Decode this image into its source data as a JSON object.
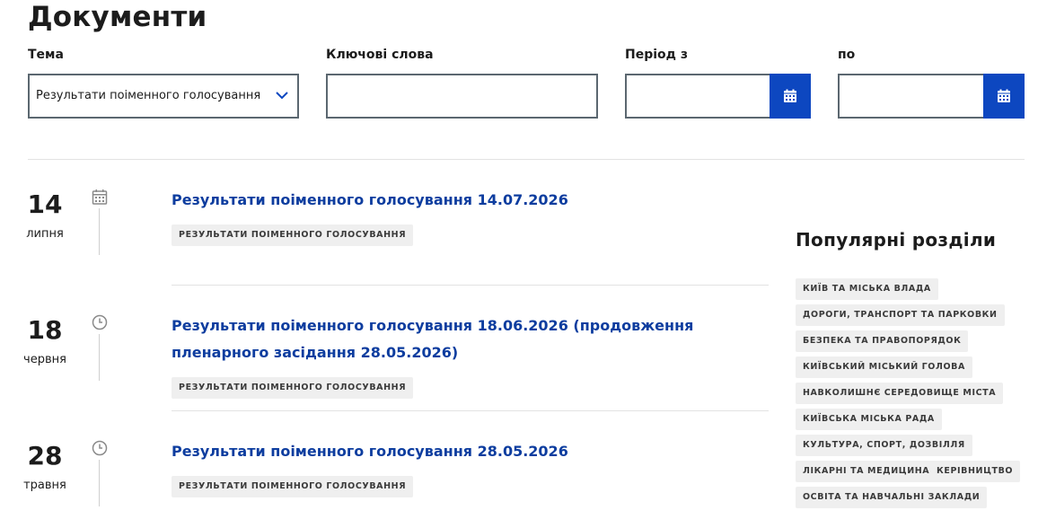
{
  "page": {
    "title": "Документи"
  },
  "filters": {
    "topic_label": "Тема",
    "topic_value": "Результати поіменного голосування",
    "keywords_label": "Ключові слова",
    "keywords_value": "",
    "period_from_label": "Період з",
    "period_to_label": "по"
  },
  "documents": [
    {
      "day": "14",
      "month": "липня",
      "icon": "calendar-icon",
      "title": "Результати поіменного голосування 14.07.2026",
      "tag": "РЕЗУЛЬТАТИ ПОІМЕННОГО ГОЛОСУВАННЯ"
    },
    {
      "day": "18",
      "month": "червня",
      "icon": "clock-icon",
      "title": "Результати поіменного голосування 18.06.2026 (продовження пленарного засідання 28.05.2026)",
      "tag": "РЕЗУЛЬТАТИ ПОІМЕННОГО ГОЛОСУВАННЯ"
    },
    {
      "day": "28",
      "month": "травня",
      "icon": "clock-icon",
      "title": "Результати поіменного голосування 28.05.2026",
      "tag": "РЕЗУЛЬТАТИ ПОІМЕННОГО ГОЛОСУВАННЯ"
    }
  ],
  "popular": {
    "title": "Популярні розділи",
    "tags": [
      "КИЇВ ТА МІСЬКА ВЛАДА",
      "ДОРОГИ, ТРАНСПОРТ ТА ПАРКОВКИ",
      "БЕЗПЕКА ТА ПРАВОПОРЯДОК",
      "КИЇВСЬКИЙ МІСЬКИЙ ГОЛОВА",
      "НАВКОЛИШНЄ СЕРЕДОВИЩЕ МІСТА",
      "КИЇВСЬКА МІСЬКА РАДА",
      "КУЛЬТУРА, СПОРТ, ДОЗВІЛЛЯ",
      "ЛІКАРНІ ТА МЕДИЦИНА",
      "КЕРІВНИЦТВО",
      "ОСВІТА ТА НАВЧАЛЬНІ ЗАКЛАДИ"
    ]
  },
  "colors": {
    "accent": "#0d47c0",
    "link": "#0d3d9f",
    "tag_bg": "#efefef",
    "border": "#5b6770"
  }
}
